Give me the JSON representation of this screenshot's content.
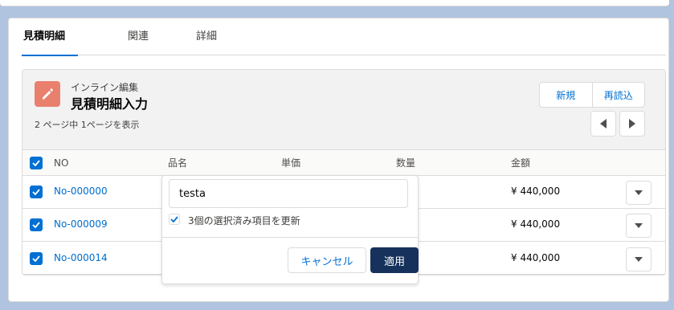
{
  "tabs": [
    {
      "label": "見積明細",
      "active": true
    },
    {
      "label": "関連",
      "active": false
    },
    {
      "label": "詳細",
      "active": false
    }
  ],
  "panel": {
    "icon": "edit-icon",
    "subtitle": "インライン編集",
    "title": "見積明細入力",
    "page_info": "2 ページ中 1ページを表示",
    "buttons": {
      "new": "新規",
      "reload": "再読込"
    }
  },
  "table": {
    "columns": [
      "NO",
      "品名",
      "単価",
      "数量",
      "金額"
    ],
    "rows": [
      {
        "no": "No-000000",
        "amount": "¥ 440,000",
        "selected": true
      },
      {
        "no": "No-000009",
        "amount": "¥ 440,000",
        "selected": true
      },
      {
        "no": "No-000014",
        "amount": "¥ 440,000",
        "selected": true
      }
    ]
  },
  "popover": {
    "input_value": "testa",
    "apply_to_selected_label": "3個の選択済み項目を更新",
    "apply_to_selected_checked": true,
    "cancel_label": "キャンセル",
    "apply_label": "適用"
  },
  "colors": {
    "background": "#b0c4df",
    "link": "#006dcc",
    "brand": "#0070d2",
    "icon_bg": "#e9806e",
    "apply_button": "#16325c"
  }
}
